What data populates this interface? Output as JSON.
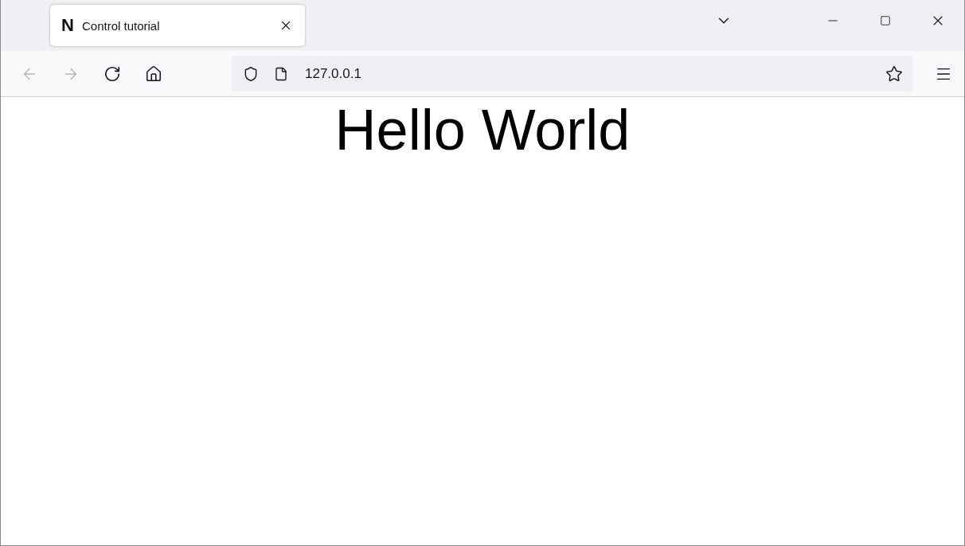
{
  "tabs": [
    {
      "favicon": "N",
      "title": "Control tutorial",
      "selected": true
    }
  ],
  "nav": {
    "back": {
      "disabled": true
    },
    "forward": {
      "disabled": true
    }
  },
  "address": {
    "url": "127.0.0.1"
  },
  "page": {
    "heading": "Hello World"
  }
}
